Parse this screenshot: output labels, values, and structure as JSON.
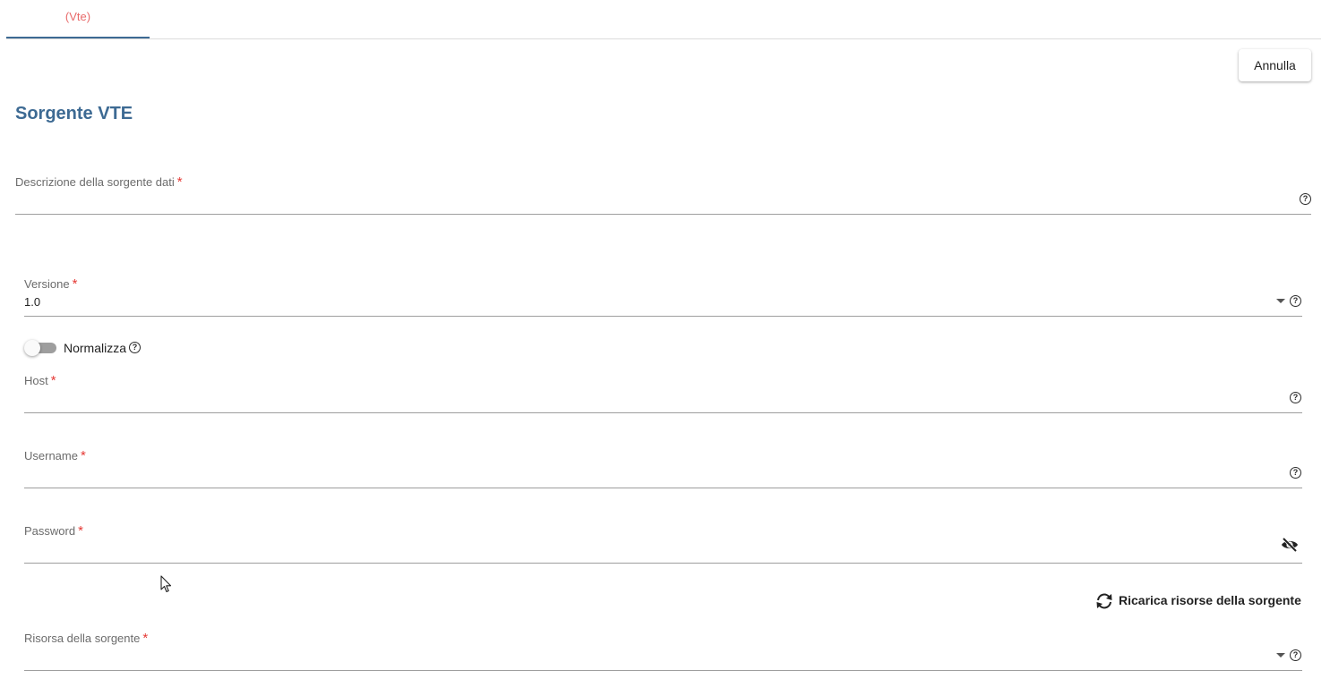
{
  "tabs": [
    {
      "label": "(Vte)",
      "active": true
    }
  ],
  "actions": {
    "cancel_label": "Annulla"
  },
  "section": {
    "title": "Sorgente VTE"
  },
  "fields": {
    "description": {
      "label": "Descrizione della sorgente dati",
      "required_mark": "*",
      "value": ""
    },
    "version": {
      "label": "Versione",
      "required_mark": "*",
      "value": "1.0"
    },
    "normalize": {
      "label": "Normalizza",
      "checked": false
    },
    "host": {
      "label": "Host",
      "required_mark": "*",
      "value": ""
    },
    "username": {
      "label": "Username",
      "required_mark": "*",
      "value": ""
    },
    "password": {
      "label": "Password",
      "required_mark": "*",
      "value": ""
    },
    "resource": {
      "label": "Risorsa della sorgente",
      "required_mark": "*",
      "value": ""
    }
  },
  "reload": {
    "label": "Ricarica risorse della sorgente"
  },
  "icons": {
    "help": "help-circle-icon",
    "dropdown": "caret-down-icon",
    "password_visibility": "eye-off-icon",
    "reload": "refresh-icon"
  },
  "colors": {
    "accent": "#3d6a93",
    "tab_text": "#e86a6a",
    "required": "#e53935"
  }
}
